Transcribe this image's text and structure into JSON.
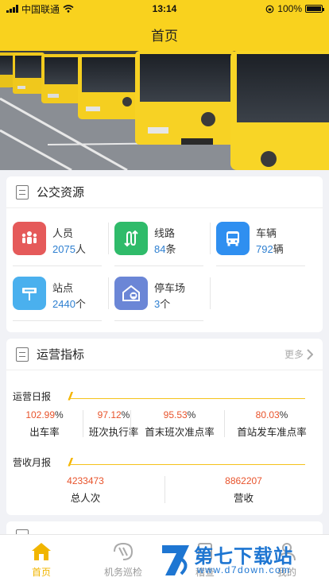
{
  "status_bar": {
    "carrier": "中国联通",
    "time": "13:14",
    "battery": "100%"
  },
  "header": {
    "title": "首页"
  },
  "bus_resources": {
    "title": "公交资源",
    "items": [
      {
        "label": "人员",
        "value": "2075",
        "unit": "人",
        "icon": "people-icon",
        "color": "#e55a5a"
      },
      {
        "label": "线路",
        "value": "84",
        "unit": "条",
        "icon": "route-icon",
        "color": "#2fbb6a"
      },
      {
        "label": "车辆",
        "value": "792",
        "unit": "辆",
        "icon": "bus-icon",
        "color": "#2f8ff0"
      },
      {
        "label": "站点",
        "value": "2440",
        "unit": "个",
        "icon": "bus-stop-icon",
        "color": "#4ab0ee"
      },
      {
        "label": "停车场",
        "value": "3",
        "unit": "个",
        "icon": "parking-lot-icon",
        "color": "#6b86d6"
      }
    ]
  },
  "operations": {
    "title": "运营指标",
    "more_label": "更多",
    "daily_report": {
      "label": "运营日报",
      "metrics": [
        {
          "value": "102.99",
          "unit": "%",
          "label": "出车率"
        },
        {
          "value": "97.12",
          "unit": "%",
          "label": "班次执行率"
        },
        {
          "value": "95.53",
          "unit": "%",
          "label": "首末班次准点率"
        },
        {
          "value": "80.03",
          "unit": "%",
          "label": "首站发车准点率"
        }
      ]
    },
    "monthly_revenue": {
      "label": "营收月报",
      "metrics": [
        {
          "value": "4233473",
          "label": "总人次"
        },
        {
          "value": "8862207",
          "label": "营收"
        }
      ]
    }
  },
  "tab_bar": {
    "items": [
      {
        "label": "首页",
        "active": true
      },
      {
        "label": "机务巡检",
        "active": false
      },
      {
        "label": "稽查",
        "active": false
      },
      {
        "label": "我的",
        "active": false
      }
    ]
  },
  "watermark": {
    "title": "第七下载站",
    "url": "www.d7down.com"
  },
  "colors": {
    "brand_yellow": "#f9d21e",
    "value_blue": "#2f80d1",
    "metric_orange": "#e8532b",
    "tab_active": "#f1b500"
  }
}
